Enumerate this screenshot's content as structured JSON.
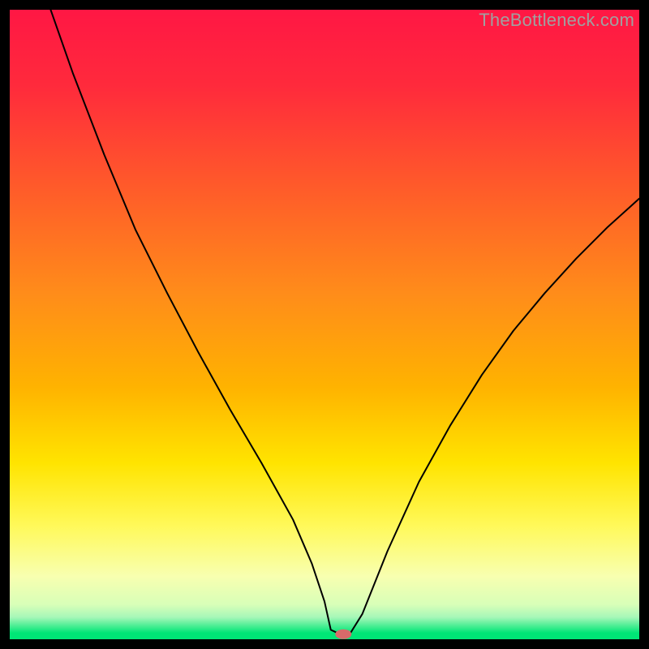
{
  "watermark": "TheBottleneck.com",
  "chart_data": {
    "type": "line",
    "title": "",
    "xlabel": "",
    "ylabel": "",
    "xlim": [
      0,
      100
    ],
    "ylim": [
      0,
      100
    ],
    "background_gradient_stops": [
      {
        "pos": 0.0,
        "color": "#ff1744"
      },
      {
        "pos": 0.12,
        "color": "#ff2a3c"
      },
      {
        "pos": 0.28,
        "color": "#ff5a2a"
      },
      {
        "pos": 0.45,
        "color": "#ff8c1a"
      },
      {
        "pos": 0.6,
        "color": "#ffb300"
      },
      {
        "pos": 0.72,
        "color": "#ffe400"
      },
      {
        "pos": 0.82,
        "color": "#fff95a"
      },
      {
        "pos": 0.9,
        "color": "#f8ffb0"
      },
      {
        "pos": 0.945,
        "color": "#d8ffb8"
      },
      {
        "pos": 0.965,
        "color": "#a6f7b8"
      },
      {
        "pos": 0.99,
        "color": "#00e676"
      },
      {
        "pos": 1.0,
        "color": "#00e676"
      }
    ],
    "series": [
      {
        "name": "bottleneck-curve",
        "stroke": "#000000",
        "stroke_width": 2,
        "x": [
          6.5,
          10,
          15,
          20,
          25,
          30,
          35,
          40,
          45,
          48,
          50,
          51,
          52.5,
          54,
          56,
          60,
          65,
          70,
          75,
          80,
          85,
          90,
          95,
          100
        ],
        "y": [
          100,
          90,
          77,
          65,
          55,
          45.5,
          36.5,
          28,
          19,
          12,
          6,
          1.5,
          0.8,
          0.8,
          4,
          14,
          25,
          34,
          42,
          49,
          55,
          60.5,
          65.5,
          70
        ]
      }
    ],
    "marker": {
      "name": "optimum-marker",
      "x": 53,
      "y": 0.8,
      "color": "#d86a6a",
      "rx": 10,
      "ry": 6
    }
  }
}
